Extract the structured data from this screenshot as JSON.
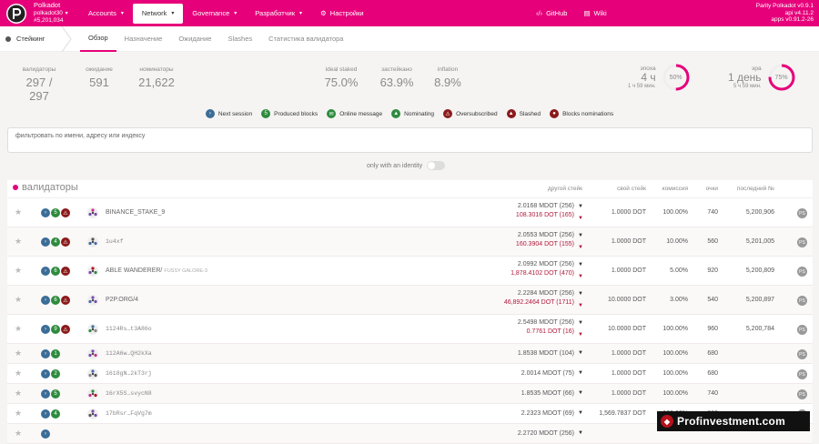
{
  "topbar": {
    "chain_name": "Polkadot",
    "chain_sub": "polkadot30",
    "block": "#5,201,034",
    "nav": [
      {
        "label": "Accounts",
        "caret": true
      },
      {
        "label": "Network",
        "caret": true,
        "active": true
      },
      {
        "label": "Governance",
        "caret": true
      },
      {
        "label": "Разработчик",
        "caret": true
      },
      {
        "label": "Настройки",
        "caret": false
      }
    ],
    "github": "GitHub",
    "wiki": "Wiki",
    "version_line1": "Parity Polkadot v0.9.1",
    "version_line2": "api v4.11.2",
    "version_line3": "apps v0.91.2-26"
  },
  "subbar": {
    "section": "Стейкинг",
    "tabs": [
      "Обзор",
      "Назначение",
      "Ожидание",
      "Slashes",
      "Статистика валидатора"
    ]
  },
  "summary": {
    "validators_label": "валидаторы",
    "validators_value": "297 / 297",
    "waiting_label": "ожидание",
    "waiting_value": "591",
    "nominators_label": "номинаторы",
    "nominators_value": "21,622",
    "ideal_label": "ideal staked",
    "ideal_value": "75.0%",
    "staked_label": "застейкано",
    "staked_value": "63.9%",
    "inflation_label": "inflation",
    "inflation_value": "8.9%",
    "epoch_label": "эпоха",
    "epoch_big": "4 ч",
    "epoch_small": "1 ч 59 мин.",
    "epoch_pct": "50%",
    "epoch_fraction": 0.5,
    "era_label": "эра",
    "era_big": "1 день",
    "era_small": "5 ч 59 мин.",
    "era_pct": "75%",
    "era_fraction": 0.75
  },
  "legend": [
    {
      "label": "Next session",
      "color": "#3b6d97",
      "glyph": "›"
    },
    {
      "label": "Produced blocks",
      "color": "#2e8b3e",
      "glyph": "5"
    },
    {
      "label": "Online message",
      "color": "#2e8b3e",
      "glyph": "✉"
    },
    {
      "label": "Nominating",
      "color": "#2e8b3e",
      "glyph": "▲"
    },
    {
      "label": "Oversubscribed",
      "color": "#8b1a1a",
      "glyph": "⚠"
    },
    {
      "label": "Slashed",
      "color": "#8b1a1a",
      "glyph": "▲"
    },
    {
      "label": "Blocks nominations",
      "color": "#8b1a1a",
      "glyph": "●"
    }
  ],
  "filter_placeholder": "фильтровать по имени, адресу или индексу",
  "toggle_label": "only with an identity",
  "table": {
    "title": "валидаторы",
    "col_other": "другой стейк",
    "col_own": "свой стейк",
    "col_comm": "комиссия",
    "col_points": "очки",
    "col_last": "последний №",
    "rows": [
      {
        "produced": "5",
        "name": "BINANCE_STAKE_9",
        "sub": "",
        "mono": false,
        "other1": "2.0168 MDOT (256)",
        "other2": "108.3016 DOT (165)",
        "own": "1.0000 DOT",
        "comm": "100.00%",
        "pts": "740",
        "last": "5,200,906",
        "tall": true
      },
      {
        "produced": "4",
        "name": "1u4xf",
        "sub": "",
        "mono": true,
        "other1": "2.0553 MDOT (256)",
        "other2": "160.3904 DOT (155)",
        "own": "1.0000 DOT",
        "comm": "10.00%",
        "pts": "560",
        "last": "5,201,005",
        "tall": true
      },
      {
        "produced": "6",
        "name": "ABLE WANDERER/",
        "sub": "FUSSY GALORE-3",
        "mono": false,
        "other1": "2.0992 MDOT (256)",
        "other2": "1,878.4102 DOT (470)",
        "own": "1.0000 DOT",
        "comm": "5.00%",
        "pts": "920",
        "last": "5,200,809",
        "tall": true
      },
      {
        "produced": "6",
        "name": "P2P.ORG/4",
        "sub": "",
        "mono": false,
        "other1": "2.2284 MDOT (256)",
        "other2": "46,892.2464 DOT (1711)",
        "own": "10.0000 DOT",
        "comm": "3.00%",
        "pts": "540",
        "last": "5,200,897",
        "tall": true
      },
      {
        "produced": "9",
        "name": "1124Rs…t3A86o",
        "sub": "",
        "mono": true,
        "other1": "2.5498 MDOT (256)",
        "other2": "0.7761 DOT (16)",
        "own": "10.0000 DOT",
        "comm": "100.00%",
        "pts": "960",
        "last": "5,200,784",
        "tall": true
      },
      {
        "produced": "1",
        "name": "112A6w…QH2kXa",
        "sub": "",
        "mono": true,
        "other1": "1.8538 MDOT (104)",
        "other2": "",
        "own": "1.0000 DOT",
        "comm": "100.00%",
        "pts": "680",
        "last": "",
        "tall": false
      },
      {
        "produced": "2",
        "name": "1618gN…2kT3rj",
        "sub": "",
        "mono": true,
        "other1": "2.0014 MDOT (75)",
        "other2": "",
        "own": "1.0000 DOT",
        "comm": "100.00%",
        "pts": "680",
        "last": "",
        "tall": false
      },
      {
        "produced": "5",
        "name": "16rX5S…svycN8",
        "sub": "",
        "mono": true,
        "other1": "1.8535 MDOT (66)",
        "other2": "",
        "own": "1.0000 DOT",
        "comm": "100.00%",
        "pts": "740",
        "last": "",
        "tall": false
      },
      {
        "produced": "4",
        "name": "17bRsr…FqVg7m",
        "sub": "",
        "mono": true,
        "other1": "2.2323 MDOT (69)",
        "other2": "",
        "own": "1,569.7837 DOT",
        "comm": "100.00%",
        "pts": "680",
        "last": "",
        "tall": false
      },
      {
        "produced": "",
        "name": "",
        "sub": "",
        "mono": true,
        "other1": "2.2720 MDOT (256)",
        "other2": "",
        "own": "",
        "comm": "",
        "pts": "",
        "last": "",
        "tall": false
      }
    ]
  },
  "watermark": "Profinvestment.com",
  "colors": {
    "brand": "#e6007a",
    "red": "#b0193a",
    "blue": "#3b6d97",
    "green": "#2e8b3e"
  }
}
